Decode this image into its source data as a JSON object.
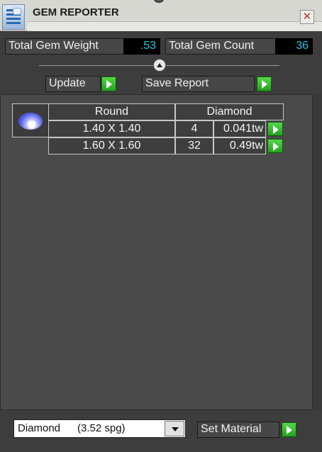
{
  "window": {
    "title": "GEM REPORTER",
    "close_glyph": "✕"
  },
  "summary": {
    "total_weight_label": "Total Gem Weight",
    "total_weight_value": ".53",
    "total_count_label": "Total Gem Count",
    "total_count_value": "36"
  },
  "actions": {
    "update_label": "Update",
    "save_label": "Save Report"
  },
  "report": {
    "gem_icon": "round-gem-icon",
    "header": {
      "shape": "Round",
      "material": "Diamond"
    },
    "rows": [
      {
        "size": "1.40 X 1.40",
        "count": "4",
        "weight": "0.041tw"
      },
      {
        "size": "1.60 X 1.60",
        "count": "32",
        "weight": "0.49tw"
      }
    ]
  },
  "material": {
    "name": "Diamond",
    "spg": "(3.52 spg)",
    "set_label": "Set Material"
  },
  "colors": {
    "background": "#3d3d3d",
    "value_text": "#20c8e0",
    "play_green": "#24a020"
  }
}
